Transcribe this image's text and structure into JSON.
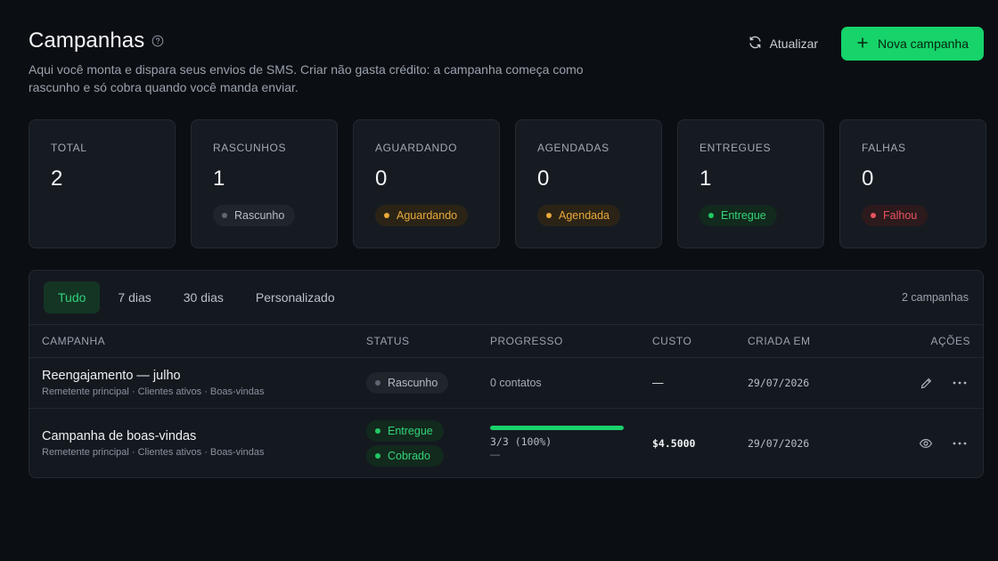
{
  "header": {
    "title": "Campanhas",
    "subtitle": "Aqui você monta e dispara seus envios de SMS. Criar não gasta crédito: a campanha começa como rascunho e só cobra quando você manda enviar.",
    "refresh_label": "Atualizar",
    "new_label": "Nova campanha"
  },
  "stats": [
    {
      "label": "TOTAL",
      "value": "2",
      "badge": null
    },
    {
      "label": "RASCUNHOS",
      "value": "1",
      "badge": "Rascunho"
    },
    {
      "label": "AGUARDANDO",
      "value": "0",
      "badge": "Aguardando"
    },
    {
      "label": "AGENDADAS",
      "value": "0",
      "badge": "Agendada"
    },
    {
      "label": "ENTREGUES",
      "value": "1",
      "badge": "Entregue"
    },
    {
      "label": "FALHAS",
      "value": "0",
      "badge": "Falhou"
    }
  ],
  "filters": {
    "tabs": [
      "Tudo",
      "7 dias",
      "30 dias",
      "Personalizado"
    ],
    "active": "Tudo",
    "count": "2 campanhas"
  },
  "table": {
    "headers": [
      "CAMPANHA",
      "STATUS",
      "PROGRESSO",
      "CUSTO",
      "CRIADA EM",
      "AÇÕES"
    ],
    "rows": [
      {
        "name": "Reengajamento — julho",
        "meta": "Remetente principal · Clientes ativos · Boas-vindas",
        "status": [
          "Rascunho"
        ],
        "progress_text": "0 contatos",
        "cost": "—",
        "created": "29/07/2026"
      },
      {
        "name": "Campanha de boas-vindas",
        "meta": "Remetente principal · Clientes ativos · Boas-vindas",
        "status": [
          "Entregue",
          "Cobrado"
        ],
        "progress_fraction": 1.0,
        "progress_text": "3/3 (100%)",
        "progress_sub": "—",
        "cost": "$4.5000",
        "created": "29/07/2026"
      }
    ]
  },
  "colors": {
    "accent": "#16d36a",
    "background": "#0b0e13",
    "card": "#161b22",
    "amber": "#e9a93a",
    "red": "#e8545e"
  }
}
